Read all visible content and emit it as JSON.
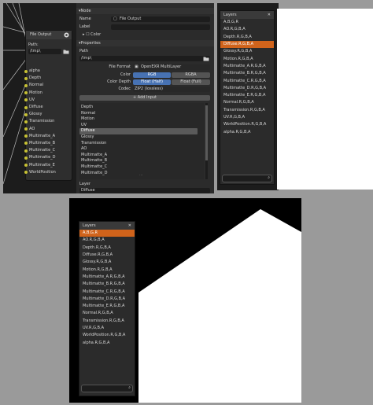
{
  "node_editor": {
    "node_title": "File Output",
    "path_label": "Path:",
    "path_value": "/tmp\\",
    "inputs": [
      "alpha",
      "Depth",
      "Normal",
      "Motion",
      "UV",
      "Diffuse",
      "Glossy",
      "Transmission",
      "AO",
      "Multimatte_A",
      "Multimatte_B",
      "Multimatte_C",
      "Multimatte_D",
      "Multimatte_E",
      "WorldPosition"
    ],
    "socket_color": "#c8c233"
  },
  "properties": {
    "node_section": "Node",
    "name_label": "Name",
    "name_value": "File Output",
    "label_label": "Label",
    "color_label": "Color",
    "properties_section": "Properties",
    "path_label": "Path",
    "path_value": "/tmp\\",
    "file_format_label": "File Format",
    "file_format_value": "OpenEXR MultiLayer",
    "color_label2": "Color",
    "color_options": [
      "RGB",
      "RGBA"
    ],
    "color_depth_label": "Color Depth",
    "color_depth_options": [
      "Float (Half)",
      "Float (Full)"
    ],
    "codec_label": "Codec",
    "codec_value": "ZIP2 (lossless)",
    "add_input_label": "Add Input",
    "input_list": [
      "Depth",
      "Normal",
      "Motion",
      "UV",
      "Diffuse",
      "Glossy",
      "Transmission",
      "AO",
      "Multimatte_A",
      "Multimatte_B",
      "Multimatte_C",
      "Multimatte_D"
    ],
    "selected_input": "Diffuse",
    "layer_label": "Layer",
    "layer_value": "Diffuse",
    "accent": "#4772b3"
  },
  "layers_top": {
    "title": "Layers",
    "items": [
      "A,B,G,R",
      "AO.R,G,B,A",
      "Depth.R,G,B,A",
      "Diffuse.R,G,B,A",
      "Glossy.R,G,B,A",
      "Motion.R,G,B,A",
      "Multimatte_A.R,G,B,A",
      "Multimatte_B.R,G,B,A",
      "Multimatte_C.R,G,B,A",
      "Multimatte_D.R,G,B,A",
      "Multimatte_E.R,G,B,A",
      "Normal.R,G,B,A",
      "Transmission.R,G,B,A",
      "UV.R,G,B,A",
      "WorldPosition.R,G,B,A",
      "alpha.R,G,B,A"
    ],
    "selected": "Diffuse.R,G,B,A",
    "highlight": "#d0631b"
  },
  "layers_bottom": {
    "title": "Layers",
    "items": [
      "A,B,G,R",
      "AO.R,G,B,A",
      "Depth.R,G,B,A",
      "Diffuse.R,G,B,A",
      "Glossy.R,G,B,A",
      "Motion.R,G,B,A",
      "Multimatte_A.R,G,B,A",
      "Multimatte_B.R,G,B,A",
      "Multimatte_C.R,G,B,A",
      "Multimatte_D.R,G,B,A",
      "Multimatte_E.R,G,B,A",
      "Normal.R,G,B,A",
      "Transmission.R,G,B,A",
      "UV.R,G,B,A",
      "WorldPosition.R,G,B,A",
      "alpha.R,G,B,A"
    ],
    "selected": "A,B,G,R",
    "highlight": "#d0631b"
  }
}
